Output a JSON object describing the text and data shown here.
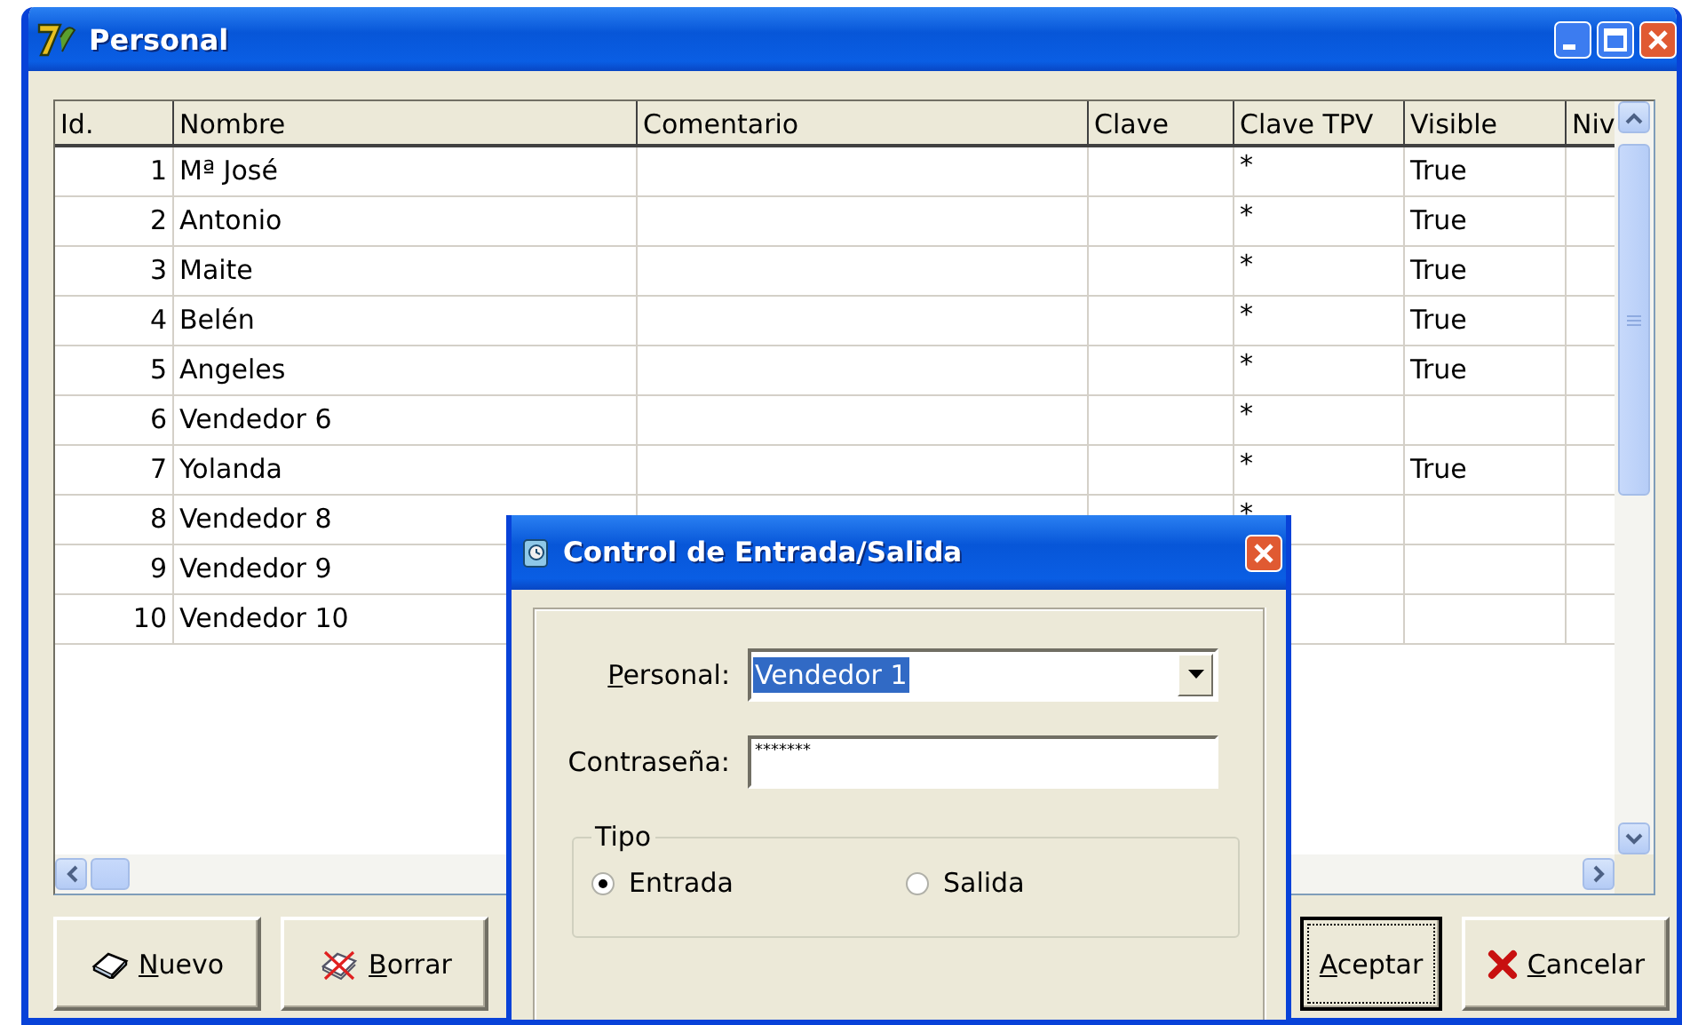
{
  "window": {
    "title": "Personal"
  },
  "table": {
    "columns": [
      "Id.",
      "Nombre",
      "Comentario",
      "Clave",
      "Clave TPV",
      "Visible",
      "Niv"
    ],
    "rows": [
      {
        "id": "1",
        "nombre": "Mª José",
        "clave_tpv": "*",
        "visible": "True"
      },
      {
        "id": "2",
        "nombre": "Antonio",
        "clave_tpv": "*",
        "visible": "True"
      },
      {
        "id": "3",
        "nombre": "Maite",
        "clave_tpv": "*",
        "visible": "True"
      },
      {
        "id": "4",
        "nombre": "Belén",
        "clave_tpv": "*",
        "visible": "True"
      },
      {
        "id": "5",
        "nombre": "Angeles",
        "clave_tpv": "*",
        "visible": "True"
      },
      {
        "id": "6",
        "nombre": "Vendedor 6",
        "clave_tpv": "*"
      },
      {
        "id": "7",
        "nombre": "Yolanda",
        "clave_tpv": "*",
        "visible": "True"
      },
      {
        "id": "8",
        "nombre": "Vendedor 8",
        "clave_tpv": "*"
      },
      {
        "id": "9",
        "nombre": "Vendedor 9"
      },
      {
        "id": "10",
        "nombre": "Vendedor 10"
      }
    ]
  },
  "buttons": [
    {
      "label": "Nuevo",
      "kind": "new"
    },
    {
      "label": "Borrar",
      "kind": "delete"
    },
    {
      "label": "Aceptar",
      "kind": "accept",
      "focused": true
    },
    {
      "label": "Cancelar",
      "kind": "cancel"
    }
  ],
  "dialog": {
    "title": "Control de Entrada/Salida",
    "fields": [
      {
        "label": "Personal:",
        "kind": "combo",
        "value": "Vendedor 1",
        "highlighted": true
      },
      {
        "label": "Contraseña:",
        "kind": "password",
        "value": "*******",
        "highlighted": false
      }
    ],
    "group": {
      "title": "Tipo",
      "options": [
        {
          "label": "Entrada",
          "selected": true
        },
        {
          "label": "Salida",
          "selected": false
        }
      ]
    }
  }
}
